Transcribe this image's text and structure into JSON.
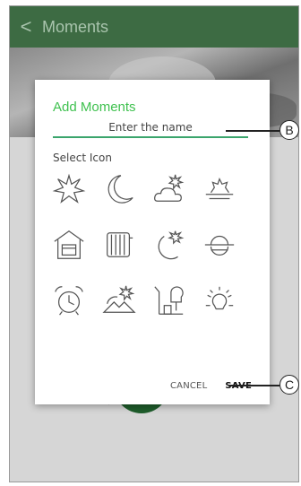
{
  "app_bar": {
    "back_glyph": "<",
    "title": "Moments"
  },
  "dialog": {
    "title": "Add Moments",
    "name_placeholder": "Enter the name",
    "select_icon_label": "Select Icon",
    "icons": [
      "starburst-icon",
      "moon-icon",
      "cloud-star-icon",
      "sunrise-icon",
      "garage-icon",
      "radiator-icon",
      "moon-star-icon",
      "horizon-icon",
      "alarm-clock-icon",
      "mountain-sun-icon",
      "home-tree-icon",
      "light-bulb-icon"
    ],
    "cancel_label": "CANCEL",
    "save_label": "SAVE"
  },
  "callouts": {
    "b": "B",
    "c": "C"
  },
  "colors": {
    "appbar": "#3d6b43",
    "accent": "#3fc14f",
    "fab": "#1f5e2c"
  }
}
